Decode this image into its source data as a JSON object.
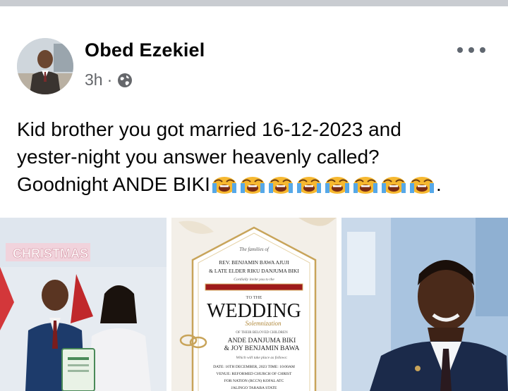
{
  "post": {
    "author": "Obed Ezekiel",
    "time": "3h",
    "separator": "·",
    "privacy_icon": "globe-icon",
    "more_icon": "more-options-icon",
    "text_line1": "Kid brother you got married 16-12-2023 and",
    "text_line2": "yester-night you answer heavenly called?",
    "text_line3": "Goodnight ANDE BIKI",
    "text_end": ".",
    "emoji_count": 8,
    "emoji_icon": "loudly-crying-face-icon"
  },
  "invitation": {
    "l1": "The families of",
    "l2": "REV. BENJAMIN BAWA AJUJI",
    "l3": "& LATE ELDER RIKU DANJUMA BIKI",
    "l4": "Cordially invite you to the",
    "l5": "TO THE",
    "l6": "WEDDING",
    "l7": "Solemnization",
    "l8": "OF THEIR BELOVED CHILDREN",
    "l9": "ANDE DANJUMA BIKI",
    "l10": "& JOY BENJAMIN BAWA",
    "l11": "Which will take place as follows:",
    "l12": "DATE: 16TH DECEMBER, 2023 TIME: 10:00AM",
    "l13": "VENUE: REFORMED CHURCH OF CHRIST",
    "l14": "FOR NATION (RCCN) KOFAL ATC",
    "l15": "JALINGO TARABA STATE"
  },
  "photo1": {
    "banner": "CHRISTMAS"
  },
  "colors": {
    "text": "#050505",
    "meta": "#65676b",
    "accent_red": "#9e1b1b",
    "gold": "#b8963e"
  }
}
